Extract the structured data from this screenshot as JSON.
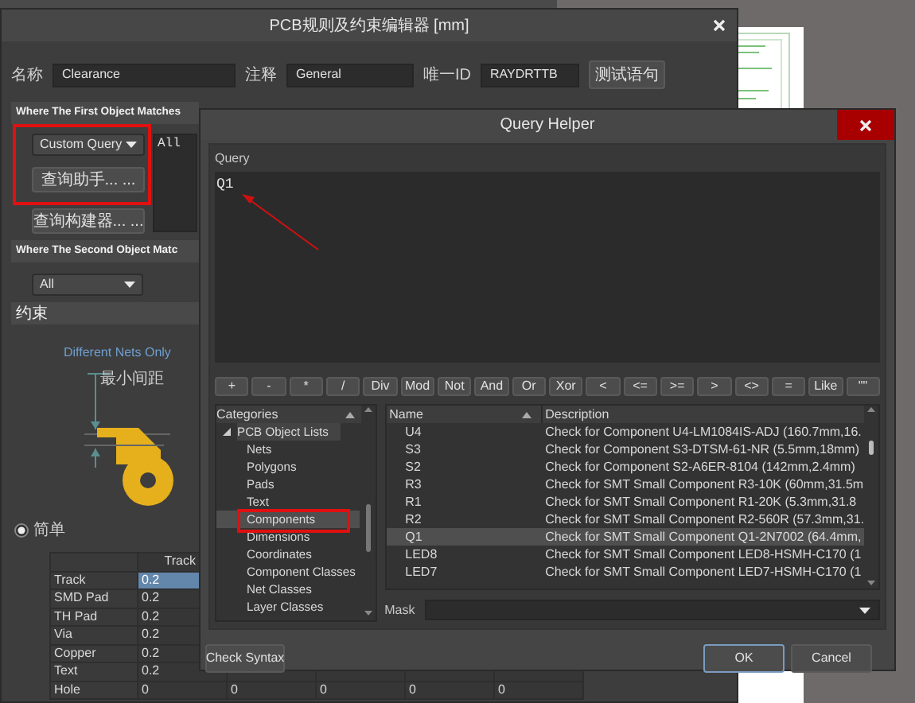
{
  "rule_editor": {
    "title": "PCB规则及约束编辑器 [mm]",
    "fields": [
      {
        "label": "名称",
        "value": "Clearance"
      },
      {
        "label": "注释",
        "value": "General"
      },
      {
        "label": "唯一ID",
        "value": "RAYDRTTB"
      }
    ],
    "test_button": "测试语句",
    "first_object": {
      "header": "Where The First Object Matches",
      "dropdown": "Custom Query",
      "query_text": "All",
      "buttons": [
        "查询助手... ...",
        "查询构建器... ..."
      ]
    },
    "second_object": {
      "header": "Where The Second Object Matc",
      "dropdown": "All"
    },
    "constraints": {
      "header": "约束",
      "net_scope": "Different Nets Only",
      "diagram_label": "最小间距",
      "radios": [
        {
          "label": "简单",
          "selected": true
        }
      ],
      "table": {
        "columns": [
          "",
          "Track"
        ],
        "rows": [
          {
            "label": "Track",
            "values": [
              "0.2"
            ],
            "selected": true
          },
          {
            "label": "SMD Pad",
            "values": [
              "0.2"
            ],
            "selected": false
          },
          {
            "label": "TH Pad",
            "values": [
              "0.2"
            ],
            "selected": false
          },
          {
            "label": "Via",
            "values": [
              "0.2"
            ],
            "selected": false
          },
          {
            "label": "Copper",
            "values": [
              "0.2"
            ],
            "selected": false
          },
          {
            "label": "Text",
            "values": [
              "0.2"
            ],
            "selected": false
          },
          {
            "label": "Hole",
            "values": [
              "0",
              "0",
              "0",
              "0",
              "0"
            ],
            "selected": false
          }
        ]
      }
    }
  },
  "query_helper": {
    "title": "Query Helper",
    "query_label": "Query",
    "query_text": "Q1",
    "operators": [
      "+",
      "-",
      "*",
      "/",
      "Div",
      "Mod",
      "Not",
      "And",
      "Or",
      "Xor",
      "<",
      "<=",
      ">=",
      ">",
      "<>",
      "=",
      "Like",
      "\"\""
    ],
    "categories": {
      "header": "Categories",
      "tree": [
        {
          "label": "PCB Object Lists",
          "expanded": true,
          "children": [
            {
              "label": "Nets",
              "selected": false
            },
            {
              "label": "Polygons",
              "selected": false
            },
            {
              "label": "Pads",
              "selected": false
            },
            {
              "label": "Text",
              "selected": false
            },
            {
              "label": "Components",
              "selected": true
            },
            {
              "label": "Dimensions",
              "selected": false
            },
            {
              "label": "Coordinates",
              "selected": false
            },
            {
              "label": "Component Classes",
              "selected": false
            },
            {
              "label": "Net Classes",
              "selected": false
            },
            {
              "label": "Layer Classes",
              "selected": false
            }
          ]
        }
      ]
    },
    "list": {
      "columns": [
        "Name",
        "Description"
      ],
      "rows": [
        {
          "name": "U4",
          "description": "Check for Component U4-LM1084IS-ADJ (160.7mm,16.",
          "selected": false
        },
        {
          "name": "S3",
          "description": "Check for Component S3-DTSM-61-NR (5.5mm,18mm)",
          "selected": false
        },
        {
          "name": "S2",
          "description": "Check for Component S2-A6ER-8104 (142mm,2.4mm)",
          "selected": false
        },
        {
          "name": "R3",
          "description": "Check for SMT Small Component R3-10K (60mm,31.5m",
          "selected": false
        },
        {
          "name": "R1",
          "description": "Check for SMT Small Component R1-20K (5.3mm,31.8",
          "selected": false
        },
        {
          "name": "R2",
          "description": "Check for SMT Small Component R2-560R (57.3mm,31.",
          "selected": false
        },
        {
          "name": "Q1",
          "description": "Check for SMT Small Component Q1-2N7002 (64.4mm,",
          "selected": true
        },
        {
          "name": "LED8",
          "description": "Check for SMT Small Component LED8-HSMH-C170 (1",
          "selected": false
        },
        {
          "name": "LED7",
          "description": "Check for SMT Small Component LED7-HSMH-C170 (1",
          "selected": false
        }
      ]
    },
    "mask_label": "Mask",
    "check_button": "Check Syntax",
    "ok_button": "OK",
    "cancel_button": "Cancel"
  }
}
